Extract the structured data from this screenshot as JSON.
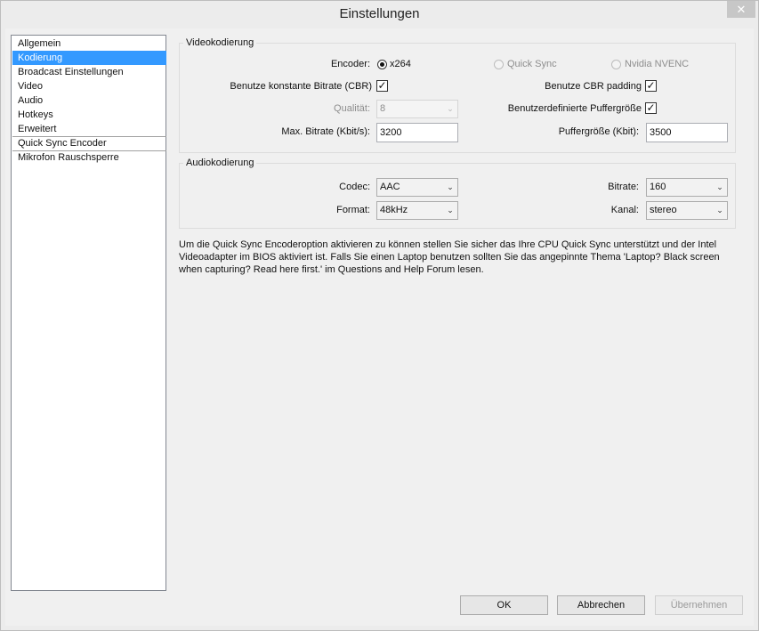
{
  "window": {
    "title": "Einstellungen",
    "close_glyph": "✕"
  },
  "sidebar": {
    "items": [
      {
        "label": "Allgemein"
      },
      {
        "label": "Kodierung",
        "selected": true
      },
      {
        "label": "Broadcast Einstellungen"
      },
      {
        "label": "Video"
      },
      {
        "label": "Audio"
      },
      {
        "label": "Hotkeys"
      },
      {
        "label": "Erweitert"
      },
      {
        "label": "Quick Sync Encoder"
      },
      {
        "label": "Mikrofon Rauschsperre"
      }
    ]
  },
  "video": {
    "group_label": "Videokodierung",
    "encoder_label": "Encoder:",
    "encoder_options": [
      {
        "label": "x264",
        "checked": true,
        "enabled": true
      },
      {
        "label": "Quick Sync",
        "checked": false,
        "enabled": false
      },
      {
        "label": "Nvidia NVENC",
        "checked": false,
        "enabled": false
      }
    ],
    "cbr_label": "Benutze konstante Bitrate (CBR)",
    "cbr_checked": true,
    "cbr_padding_label": "Benutze CBR padding",
    "cbr_padding_checked": true,
    "quality_label": "Qualität:",
    "quality_value": "8",
    "custom_buffer_label": "Benutzerdefinierte Puffergröße",
    "custom_buffer_checked": true,
    "max_bitrate_label": "Max. Bitrate (Kbit/s):",
    "max_bitrate_value": "3200",
    "buffer_size_label": "Puffergröße (Kbit):",
    "buffer_size_value": "3500",
    "check_glyph": "✓"
  },
  "audio": {
    "group_label": "Audiokodierung",
    "codec_label": "Codec:",
    "codec_value": "AAC",
    "bitrate_label": "Bitrate:",
    "bitrate_value": "160",
    "format_label": "Format:",
    "format_value": "48kHz",
    "channel_label": "Kanal:",
    "channel_value": "stereo",
    "dropdown_glyph": "⌄"
  },
  "info_text": "Um die Quick Sync Encoderoption aktivieren zu können stellen Sie sicher das Ihre CPU Quick Sync unterstützt und der Intel Videoadapter im BIOS aktiviert ist. Falls Sie einen Laptop benutzen sollten Sie das angepinnte Thema 'Laptop? Black screen when capturing? Read here first.' im Questions and Help Forum lesen.",
  "buttons": {
    "ok": "OK",
    "cancel": "Abbrechen",
    "apply": "Übernehmen"
  },
  "colors": {
    "selection": "#3399ff",
    "background": "#f0f0f0"
  }
}
